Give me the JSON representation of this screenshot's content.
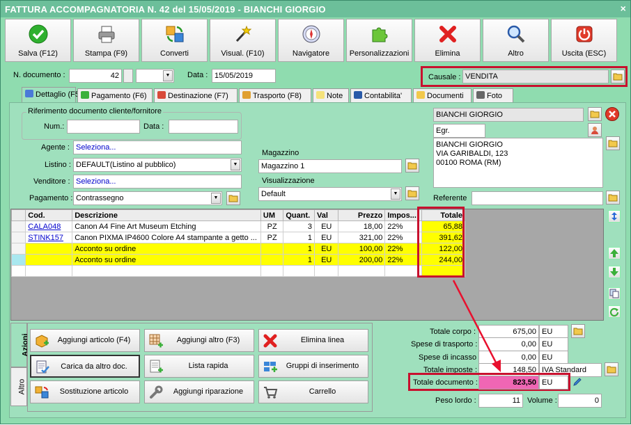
{
  "window": {
    "title": "FATTURA ACCOMPAGNATORIA N. 42 del 15/05/2019 - BIANCHI GIORGIO",
    "close": "×"
  },
  "toolbar": [
    {
      "label": "Salva (F12)",
      "icon": "check-icon"
    },
    {
      "label": "Stampa (F9)",
      "icon": "printer-icon"
    },
    {
      "label": "Converti",
      "icon": "convert-icon"
    },
    {
      "label": "Visual. (F10)",
      "icon": "magic-wand-icon"
    },
    {
      "label": "Navigatore",
      "icon": "compass-icon"
    },
    {
      "label": "Personalizzazioni",
      "icon": "puzzle-icon"
    },
    {
      "label": "Elimina",
      "icon": "delete-x-icon"
    },
    {
      "label": "Altro",
      "icon": "magnifier-icon"
    },
    {
      "label": "Uscita (ESC)",
      "icon": "power-icon"
    }
  ],
  "header": {
    "ndoc_label": "N. documento :",
    "ndoc_value": "42",
    "ndoc_suffix": "",
    "data_label": "Data :",
    "data_value": "15/05/2019",
    "causale_label": "Causale :",
    "causale_value": "VENDITA"
  },
  "tabs": [
    "Dettaglio (F5)",
    "Pagamento (F6)",
    "Destinazione (F7)",
    "Trasporto (F8)",
    "Note",
    "Contabilita'",
    "Documenti",
    "Foto"
  ],
  "riferimento": {
    "title": "Riferimento documento cliente/fornitore",
    "num_label": "Num.:",
    "num_value": "",
    "data_label": "Data :",
    "data_value": ""
  },
  "fields": {
    "agente_label": "Agente :",
    "agente_value": "Seleziona...",
    "listino_label": "Listino :",
    "listino_value": "DEFAULT(Listino al pubblico)",
    "venditore_label": "Venditore :",
    "venditore_value": "Seleziona...",
    "pagamento_label": "Pagamento :",
    "pagamento_value": "Contrassegno",
    "magazzino_title": "Magazzino",
    "magazzino_value": "Magazzino 1",
    "visualizzazione_title": "Visualizzazione",
    "visualizzazione_value": "Default"
  },
  "cliente": {
    "name": "BIANCHI GIORGIO",
    "title": "Egr.",
    "address": [
      "BIANCHI GIORGIO",
      "VIA GARIBALDI, 123",
      "00100 ROMA (RM)"
    ],
    "referente_label": "Referente",
    "referente_value": ""
  },
  "grid": {
    "columns": [
      "Cod.",
      "Descrizione",
      "UM",
      "Quant.",
      "Val",
      "Prezzo",
      "Impos...",
      "Totale"
    ],
    "rows": [
      {
        "cod": "CALA048",
        "descr": "Canon A4 Fine Art Museum Etching",
        "um": "PZ",
        "quant": "3",
        "val": "EU",
        "prezzo": "18,00",
        "impos": "22%",
        "totale": "65,88",
        "yellow": false
      },
      {
        "cod": "STINK157",
        "descr": "Canon PIXMA IP4600 Colore A4 stampante a getto ...",
        "um": "PZ",
        "quant": "1",
        "val": "EU",
        "prezzo": "321,00",
        "impos": "22%",
        "totale": "391,62",
        "yellow": false
      },
      {
        "cod": "",
        "descr": "Acconto su ordine",
        "um": "",
        "quant": "1",
        "val": "EU",
        "prezzo": "100,00",
        "impos": "22%",
        "totale": "122,00",
        "yellow": true
      },
      {
        "cod": "",
        "descr": "Acconto su ordine",
        "um": "",
        "quant": "1",
        "val": "EU",
        "prezzo": "200,00",
        "impos": "22%",
        "totale": "244,00",
        "yellow": true
      }
    ]
  },
  "actions": {
    "tab_azioni": "Azioni",
    "tab_altro": "Altro",
    "buttons": [
      "Aggiungi articolo (F4)",
      "Aggiungi altro (F3)",
      "Elimina linea",
      "Carica da altro doc.",
      "Lista rapida",
      "Gruppi di inserimento",
      "Sostituzione articolo",
      "Aggiungi riparazione",
      "Carrello"
    ]
  },
  "totals": {
    "corpo_label": "Totale corpo :",
    "corpo_value": "675,00",
    "corpo_cur": "EU",
    "trasporto_label": "Spese di trasporto :",
    "trasporto_value": "0,00",
    "trasporto_cur": "EU",
    "incasso_label": "Spese di incasso :",
    "incasso_value": "0,00",
    "incasso_cur": "EU",
    "imposte_label": "Totale imposte :",
    "imposte_value": "148,50",
    "imposte_cur": "IVA Standard",
    "documento_label": "Totale documento :",
    "documento_value": "823,50",
    "documento_cur": "EU",
    "peso_label": "Peso lordo :",
    "peso_value": "11",
    "volume_label": "Volume :",
    "volume_value": "0"
  },
  "colors": {
    "background": "#9fe0bd",
    "highlight": "#c8102e",
    "yellow": "#ffff00",
    "total_pink": "#f066b4"
  }
}
